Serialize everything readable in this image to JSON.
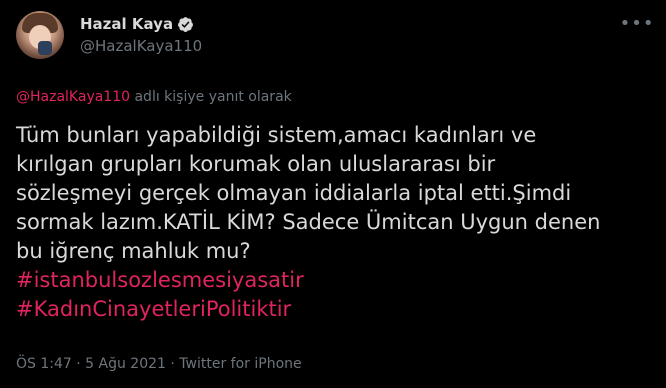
{
  "author": {
    "display_name": "Hazal Kaya",
    "handle": "@HazalKaya110",
    "verified": true,
    "avatar_icon": "profile-photo-icon"
  },
  "more_icon": "more-dots-icon",
  "reply": {
    "mention": "@HazalKaya110",
    "suffix": " adlı kişiye yanıt olarak"
  },
  "tweet": {
    "text": "Tüm bunları yapabildiği sistem,amacı kadınları ve\nkırılgan grupları korumak olan uluslararası bir\nsözleşmeyi gerçek olmayan iddialarla iptal etti.Şimdi\nsormak lazım.KATİL KİM? Sadece Ümitcan Uygun denen\nbu iğrenç mahluk mu?",
    "hashtags": [
      "#istanbulsozlesmesiyasatir",
      "#KadınCinayetleriPolitiktir"
    ]
  },
  "meta": {
    "time": "ÖS 1:47",
    "separator1": " · ",
    "date": "5 Ağu 2021",
    "separator2": " · ",
    "source": "Twitter for iPhone"
  },
  "colors": {
    "background": "#000000",
    "text": "#d9d9d9",
    "secondary": "#6e767d",
    "accent": "#e0245e",
    "verified": "#d9d9d9"
  }
}
